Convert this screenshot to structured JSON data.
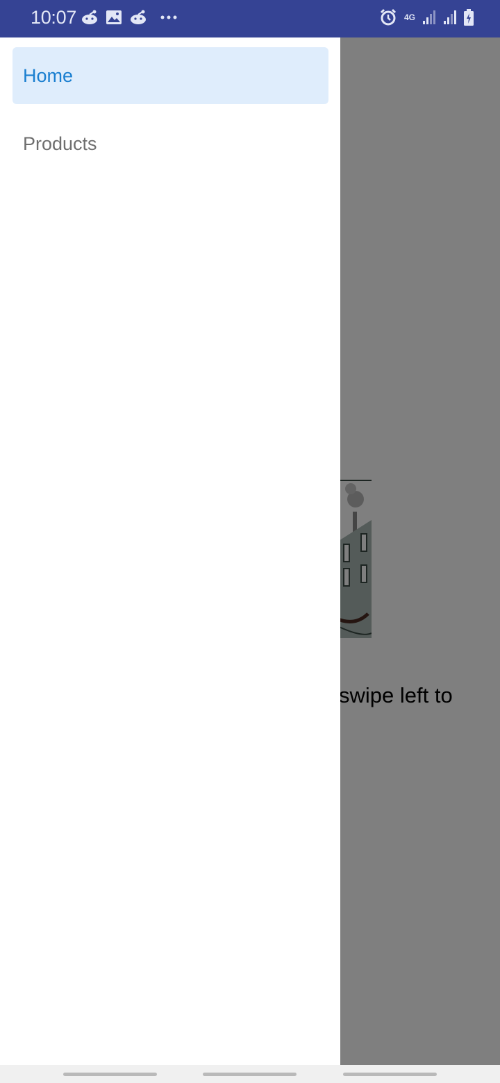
{
  "status_bar": {
    "time": "10:07",
    "left_icons": [
      "reddit-icon",
      "image-icon",
      "reddit-icon",
      "more-dots-icon"
    ],
    "network_label": "4G",
    "right_icons": [
      "alarm-icon",
      "signal-icon",
      "signal-icon",
      "battery-charging-icon"
    ]
  },
  "drawer": {
    "items": [
      {
        "label": "Home",
        "active": true
      },
      {
        "label": "Products",
        "active": false
      }
    ]
  },
  "main": {
    "partial_text": "swipe left to",
    "image_icon": "city-building-illustration"
  },
  "colors": {
    "status_bar": "#354394",
    "active_item_bg": "#dfedfc",
    "active_item_text": "#1a7fd0",
    "inactive_item_text": "#6e6e6e",
    "scrim": "rgba(0,0,0,0.5)"
  }
}
